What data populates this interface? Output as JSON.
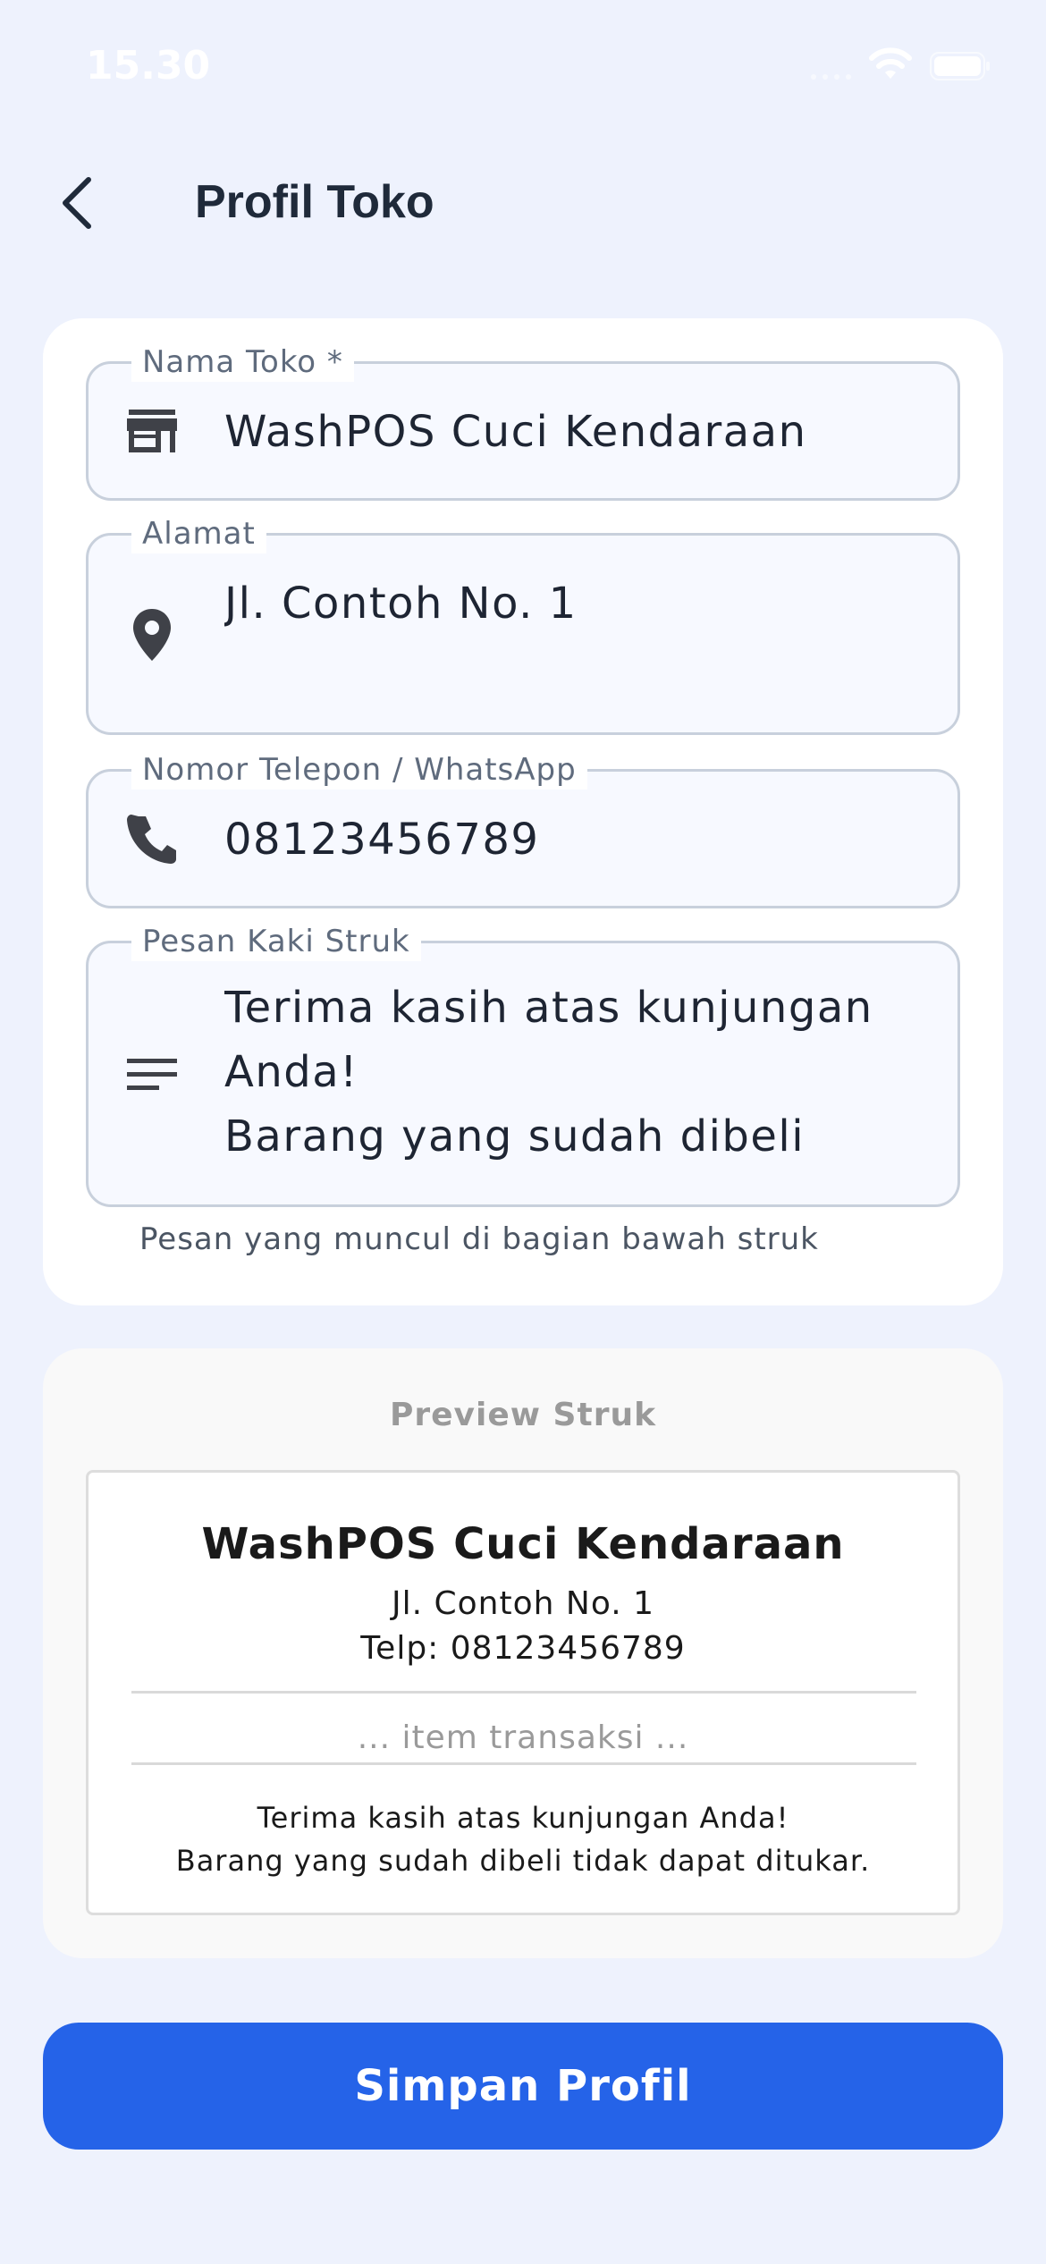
{
  "status_bar": {
    "time": "15.30"
  },
  "header": {
    "title": "Profil Toko"
  },
  "form": {
    "store_name": {
      "label": "Nama Toko *",
      "value": "WashPOS Cuci Kendaraan"
    },
    "address": {
      "label": "Alamat",
      "value": "Jl. Contoh No. 1"
    },
    "phone": {
      "label": "Nomor Telepon / WhatsApp",
      "value": "08123456789"
    },
    "footer_message": {
      "label": "Pesan Kaki Struk",
      "value": "Terima kasih atas kunjungan\nAnda!\nBarang yang sudah dibeli tidak",
      "helper": "Pesan yang muncul di bagian bawah struk"
    }
  },
  "preview": {
    "title": "Preview Struk",
    "store_name": "WashPOS Cuci Kendaraan",
    "address": "Jl. Contoh No. 1",
    "phone": "Telp: 08123456789",
    "items_placeholder": "... item transaksi ...",
    "footer": "Terima kasih atas kunjungan Anda!\nBarang yang sudah dibeli tidak dapat ditukar."
  },
  "save_button": {
    "label": "Simpan Profil"
  },
  "colors": {
    "background": "#eef2fd",
    "primary": "#2563e8",
    "field_border": "#c8d0dc",
    "field_fill": "#f7f9ff"
  }
}
